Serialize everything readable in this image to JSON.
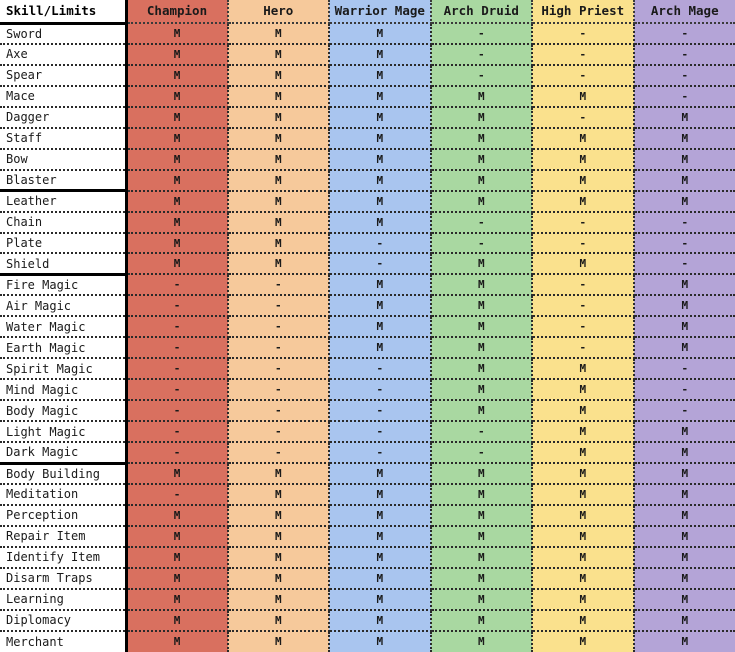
{
  "table": {
    "corner_header": "Skill/Limits",
    "mark_mastery": "M",
    "mark_none": "-",
    "columns": [
      {
        "label": "Champion",
        "color": "#d9705f"
      },
      {
        "label": "Hero",
        "color": "#f6c99b"
      },
      {
        "label": "Warrior Mage",
        "color": "#a9c5ef"
      },
      {
        "label": "Arch Druid",
        "color": "#a9d8a1"
      },
      {
        "label": "High Priest",
        "color": "#fae18d"
      },
      {
        "label": "Arch Mage",
        "color": "#b4a4d7"
      }
    ],
    "sections": [
      {
        "name": "weapons",
        "rows": [
          {
            "skill": "Sword",
            "values": [
              "M",
              "M",
              "M",
              "-",
              "-",
              "-"
            ]
          },
          {
            "skill": "Axe",
            "values": [
              "M",
              "M",
              "M",
              "-",
              "-",
              "-"
            ]
          },
          {
            "skill": "Spear",
            "values": [
              "M",
              "M",
              "M",
              "-",
              "-",
              "-"
            ]
          },
          {
            "skill": "Mace",
            "values": [
              "M",
              "M",
              "M",
              "M",
              "M",
              "-"
            ]
          },
          {
            "skill": "Dagger",
            "values": [
              "M",
              "M",
              "M",
              "M",
              "-",
              "M"
            ]
          },
          {
            "skill": "Staff",
            "values": [
              "M",
              "M",
              "M",
              "M",
              "M",
              "M"
            ]
          },
          {
            "skill": "Bow",
            "values": [
              "M",
              "M",
              "M",
              "M",
              "M",
              "M"
            ]
          },
          {
            "skill": "Blaster",
            "values": [
              "M",
              "M",
              "M",
              "M",
              "M",
              "M"
            ]
          }
        ]
      },
      {
        "name": "armor",
        "rows": [
          {
            "skill": "Leather",
            "values": [
              "M",
              "M",
              "M",
              "M",
              "M",
              "M"
            ]
          },
          {
            "skill": "Chain",
            "values": [
              "M",
              "M",
              "M",
              "-",
              "-",
              "-"
            ]
          },
          {
            "skill": "Plate",
            "values": [
              "M",
              "M",
              "-",
              "-",
              "-",
              "-"
            ]
          },
          {
            "skill": "Shield",
            "values": [
              "M",
              "M",
              "-",
              "M",
              "M",
              "-"
            ]
          }
        ]
      },
      {
        "name": "magic",
        "rows": [
          {
            "skill": "Fire Magic",
            "values": [
              "-",
              "-",
              "M",
              "M",
              "-",
              "M"
            ]
          },
          {
            "skill": "Air Magic",
            "values": [
              "-",
              "-",
              "M",
              "M",
              "-",
              "M"
            ]
          },
          {
            "skill": "Water Magic",
            "values": [
              "-",
              "-",
              "M",
              "M",
              "-",
              "M"
            ]
          },
          {
            "skill": "Earth Magic",
            "values": [
              "-",
              "-",
              "M",
              "M",
              "-",
              "M"
            ]
          },
          {
            "skill": "Spirit Magic",
            "values": [
              "-",
              "-",
              "-",
              "M",
              "M",
              "-"
            ]
          },
          {
            "skill": "Mind Magic",
            "values": [
              "-",
              "-",
              "-",
              "M",
              "M",
              "-"
            ]
          },
          {
            "skill": "Body Magic",
            "values": [
              "-",
              "-",
              "-",
              "M",
              "M",
              "-"
            ]
          },
          {
            "skill": "Light Magic",
            "values": [
              "-",
              "-",
              "-",
              "-",
              "M",
              "M"
            ]
          },
          {
            "skill": "Dark Magic",
            "values": [
              "-",
              "-",
              "-",
              "-",
              "M",
              "M"
            ]
          }
        ]
      },
      {
        "name": "misc",
        "rows": [
          {
            "skill": "Body Building",
            "values": [
              "M",
              "M",
              "M",
              "M",
              "M",
              "M"
            ]
          },
          {
            "skill": "Meditation",
            "values": [
              "-",
              "M",
              "M",
              "M",
              "M",
              "M"
            ]
          },
          {
            "skill": "Perception",
            "values": [
              "M",
              "M",
              "M",
              "M",
              "M",
              "M"
            ]
          },
          {
            "skill": "Repair Item",
            "values": [
              "M",
              "M",
              "M",
              "M",
              "M",
              "M"
            ]
          },
          {
            "skill": "Identify Item",
            "values": [
              "M",
              "M",
              "M",
              "M",
              "M",
              "M"
            ]
          },
          {
            "skill": "Disarm Traps",
            "values": [
              "M",
              "M",
              "M",
              "M",
              "M",
              "M"
            ]
          },
          {
            "skill": "Learning",
            "values": [
              "M",
              "M",
              "M",
              "M",
              "M",
              "M"
            ]
          },
          {
            "skill": "Diplomacy",
            "values": [
              "M",
              "M",
              "M",
              "M",
              "M",
              "M"
            ]
          },
          {
            "skill": "Merchant",
            "values": [
              "M",
              "M",
              "M",
              "M",
              "M",
              "M"
            ]
          }
        ]
      }
    ]
  }
}
